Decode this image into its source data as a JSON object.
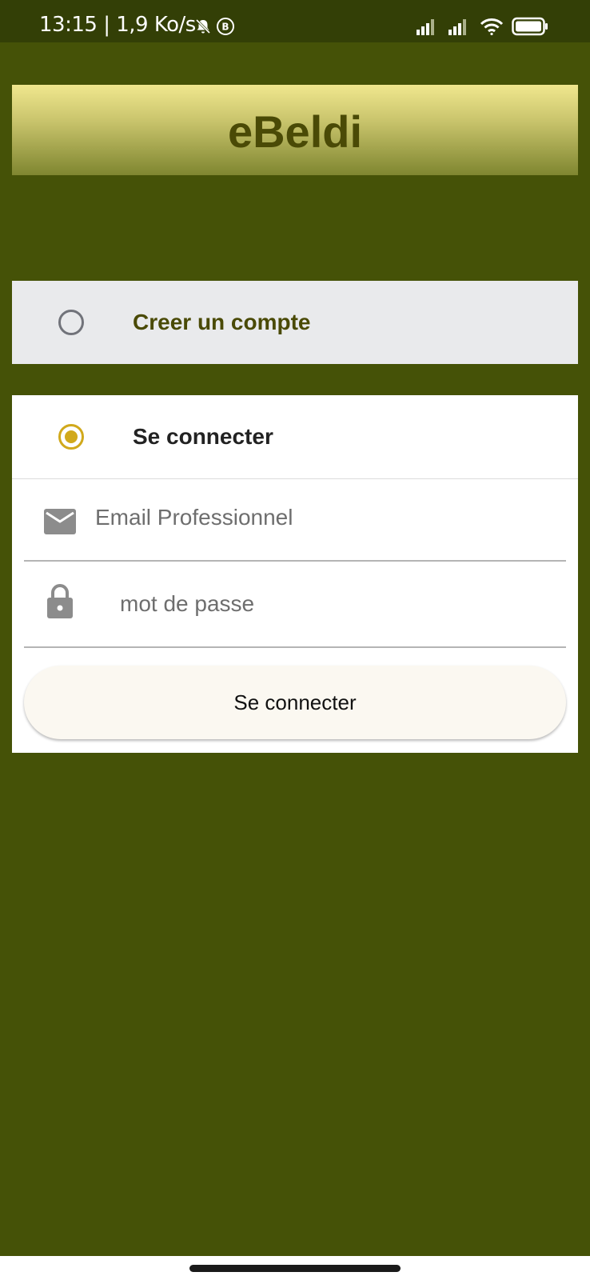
{
  "status_bar": {
    "time_speed": "13:15 | 1,9 Ko/s",
    "icons": [
      "alarm-off-icon",
      "b-circle-icon",
      "signal-icon",
      "signal-icon",
      "wifi-icon",
      "battery-icon"
    ]
  },
  "header": {
    "title": "eBeldi"
  },
  "options": {
    "create_account": {
      "label": "Creer un compte",
      "selected": false
    },
    "login": {
      "label": "Se connecter",
      "selected": true
    }
  },
  "form": {
    "email_placeholder": "Email Professionnel",
    "email_value": "",
    "password_placeholder": "mot de passe",
    "password_value": "",
    "submit_label": "Se connecter"
  },
  "colors": {
    "background": "#455207",
    "status_bar": "#333f06",
    "title_text": "#4a4a06",
    "radio_accent": "#d1a91c",
    "radio_inactive": "#71737a"
  }
}
